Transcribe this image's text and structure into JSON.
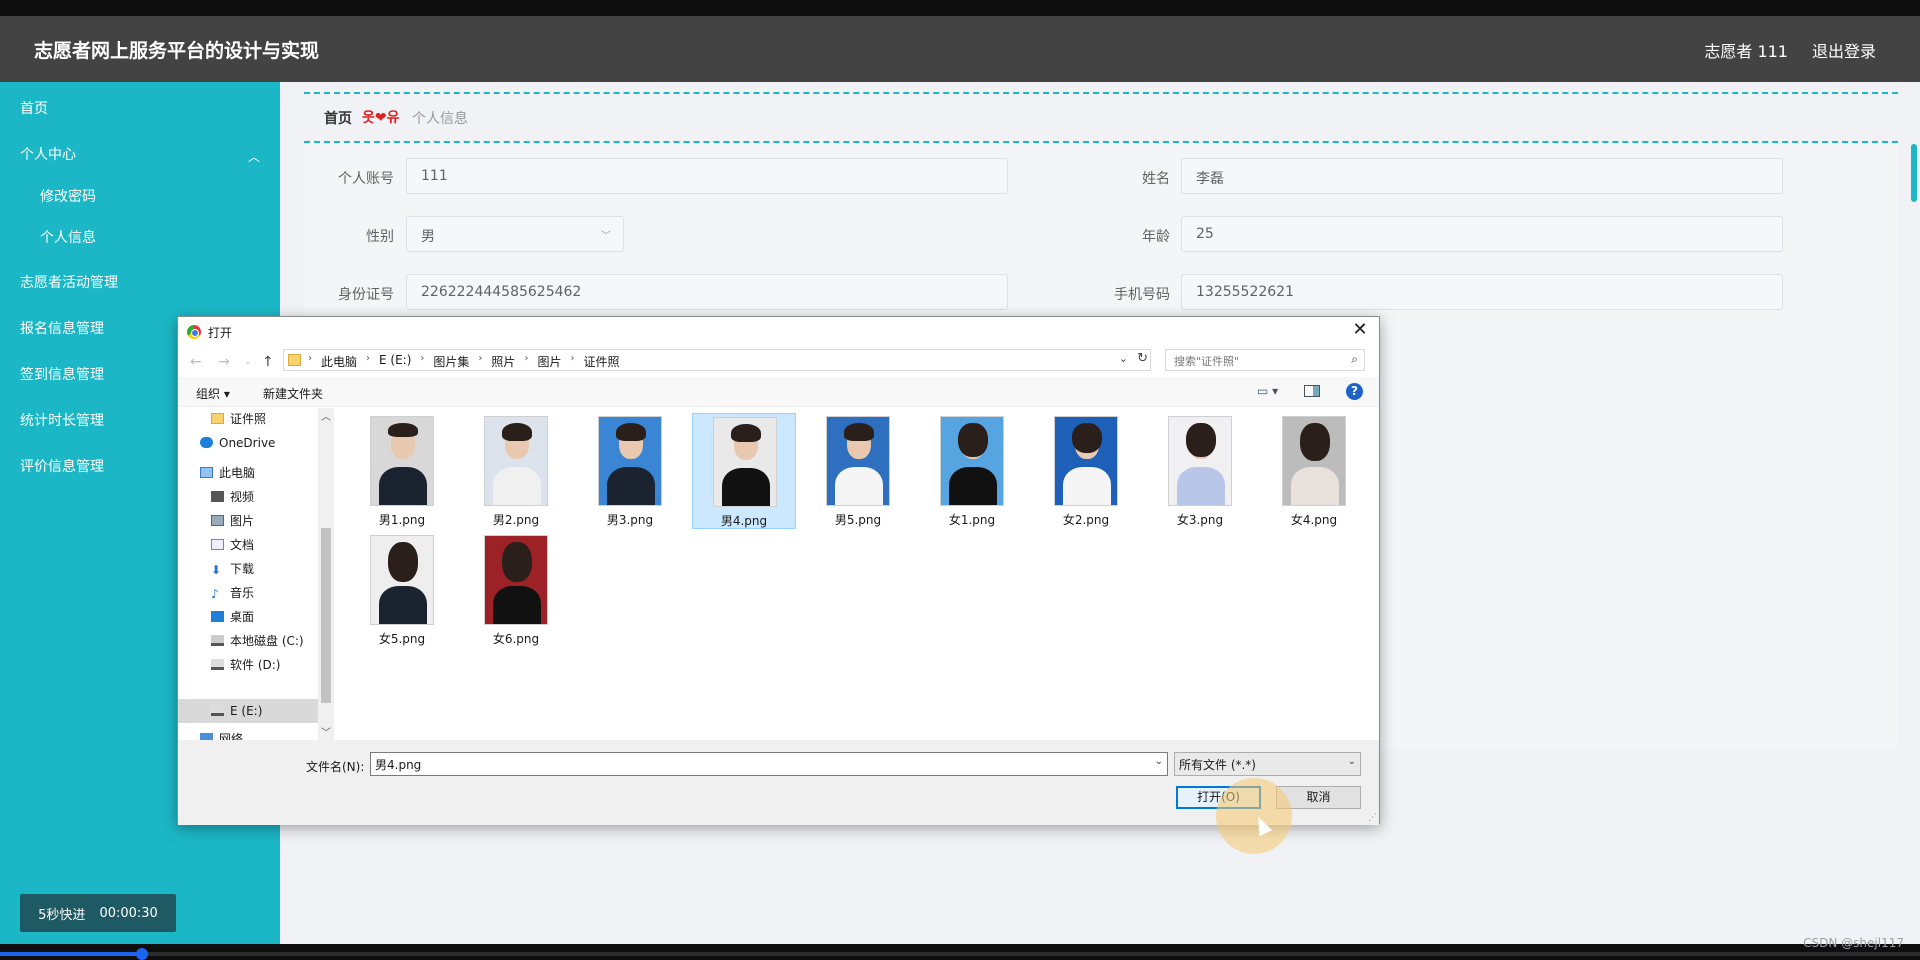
{
  "header": {
    "title": "志愿者网上服务平台的设计与实现",
    "user": "志愿者 111",
    "logout": "退出登录"
  },
  "sidebar": {
    "items": [
      {
        "label": "首页"
      },
      {
        "label": "个人中心"
      },
      {
        "label": "修改密码"
      },
      {
        "label": "个人信息"
      },
      {
        "label": "志愿者活动管理"
      },
      {
        "label": "报名信息管理"
      },
      {
        "label": "签到信息管理"
      },
      {
        "label": "统计时长管理"
      },
      {
        "label": "评价信息管理"
      }
    ]
  },
  "fast_forward": {
    "label": "5秒快进",
    "time": "00:00:30"
  },
  "breadcrumb": {
    "home": "首页",
    "separator": "옷❤유",
    "current": "个人信息"
  },
  "form": {
    "account_label": "个人账号",
    "account_value": "111",
    "name_label": "姓名",
    "name_value": "李磊",
    "gender_label": "性别",
    "gender_value": "男",
    "age_label": "年龄",
    "age_value": "25",
    "id_label": "身份证号",
    "id_value": "226222444585625462",
    "phone_label": "手机号码",
    "phone_value": "13255522621"
  },
  "dialog": {
    "title": "打开",
    "path": [
      "此电脑",
      "E (E:)",
      "图片集",
      "照片",
      "图片",
      "证件照"
    ],
    "search_placeholder": "搜索\"证件照\"",
    "organize": "组织 ▾",
    "new_folder": "新建文件夹",
    "nav_items": [
      "证件照",
      "OneDrive",
      "此电脑",
      "视频",
      "图片",
      "文档",
      "下载",
      "音乐",
      "桌面",
      "本地磁盘 (C:)",
      "软件 (D:)",
      "E (E:)",
      "网络"
    ],
    "files": [
      "男1.png",
      "男2.png",
      "男3.png",
      "男4.png",
      "男5.png",
      "女1.png",
      "女2.png",
      "女3.png",
      "女4.png",
      "女5.png",
      "女6.png"
    ],
    "selected_file": "男4.png",
    "filename_label": "文件名(N):",
    "filename_value": "男4.png",
    "filetype_value": "所有文件 (*.*)",
    "open_button": "打开(O)",
    "cancel_button": "取消"
  },
  "watermark": "CSDN @shejl117",
  "colors": {
    "sidebar": "#1bb7c6",
    "header": "#434343",
    "accent": "#0078d7"
  }
}
